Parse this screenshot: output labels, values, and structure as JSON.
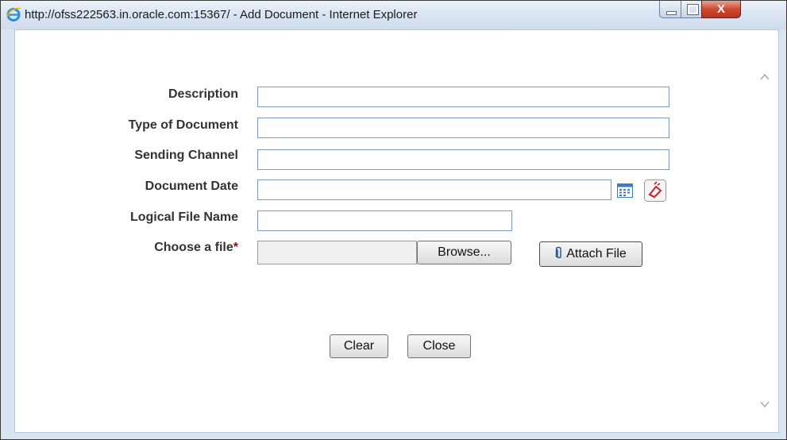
{
  "window": {
    "title": "http://ofss222563.in.oracle.com:15367/ - Add Document - Internet Explorer",
    "close_glyph": "X"
  },
  "form": {
    "fields": [
      {
        "label": "Description",
        "value": ""
      },
      {
        "label": "Type of Document",
        "value": ""
      },
      {
        "label": "Sending Channel",
        "value": ""
      },
      {
        "label": "Document Date",
        "value": ""
      },
      {
        "label": "Logical File Name",
        "value": ""
      }
    ],
    "file": {
      "label": "Choose a file",
      "required_mark": "*",
      "value": "",
      "browse_label": "Browse...",
      "attach_label": "Attach File"
    }
  },
  "actions": {
    "clear_label": "Clear",
    "close_label": "Close"
  },
  "icons": {
    "calendar": "calendar-icon",
    "eraser": "eraser-icon",
    "paperclip": "paperclip-icon",
    "browser": "internet-explorer-icon"
  },
  "colors": {
    "label_text": "#333333",
    "required": "#b30000",
    "close_button": "#cf4a31",
    "field_border": "#7a9bbd"
  }
}
